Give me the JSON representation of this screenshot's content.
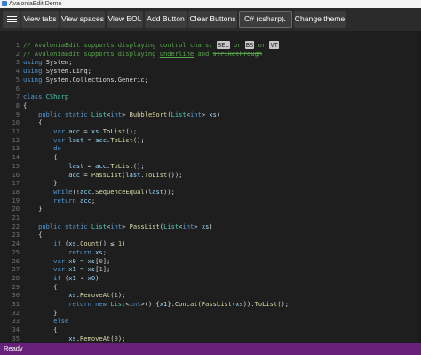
{
  "window": {
    "title": "AvaloniaEdit Demo"
  },
  "toolbar": {
    "buttons": [
      {
        "label": "View tabs"
      },
      {
        "label": "View spaces"
      },
      {
        "label": "View EOL"
      },
      {
        "label": "Add Button"
      },
      {
        "label": "Clear Buttons"
      }
    ],
    "language_select": {
      "selected": "C# (csharp)"
    },
    "theme_button": {
      "label": "Change theme"
    }
  },
  "editor": {
    "lines": [
      {
        "n": "1",
        "t": [
          [
            "cm",
            "// AvaloniaEdit supports displaying control chars: "
          ],
          [
            "ctl",
            "BEL"
          ],
          [
            "cm",
            " or "
          ],
          [
            "ctl",
            "BS"
          ],
          [
            "cm",
            " or "
          ],
          [
            "ctl",
            "VT"
          ]
        ]
      },
      {
        "n": "2",
        "t": [
          [
            "cm",
            "// AvaloniaEdit supports displaying "
          ],
          [
            "cmul",
            "underline"
          ],
          [
            "cm",
            " and "
          ],
          [
            "cmst",
            "strikethrough"
          ]
        ]
      },
      {
        "n": "3",
        "t": [
          [
            "kw",
            "using "
          ],
          [
            "pl",
            "System;"
          ]
        ]
      },
      {
        "n": "4",
        "t": [
          [
            "kw",
            "using "
          ],
          [
            "pl",
            "System.Linq;"
          ]
        ]
      },
      {
        "n": "5",
        "t": [
          [
            "kw",
            "using "
          ],
          [
            "pl",
            "System.Collections.Generic;"
          ]
        ]
      },
      {
        "n": "6",
        "t": []
      },
      {
        "n": "7",
        "t": [
          [
            "kw",
            "class "
          ],
          [
            "ty",
            "CSharp"
          ]
        ]
      },
      {
        "n": "8",
        "t": [
          [
            "pl",
            "{"
          ]
        ]
      },
      {
        "n": "9",
        "t": [
          [
            "pl",
            "    "
          ],
          [
            "kw",
            "public static "
          ],
          [
            "ty",
            "List"
          ],
          [
            "pl",
            "<"
          ],
          [
            "kw",
            "int"
          ],
          [
            "pl",
            "> "
          ],
          [
            "fn",
            "BubbleSort"
          ],
          [
            "pl",
            "("
          ],
          [
            "ty",
            "List"
          ],
          [
            "pl",
            "<"
          ],
          [
            "kw",
            "int"
          ],
          [
            "pl",
            "> "
          ],
          [
            "id",
            "xs"
          ],
          [
            "pl",
            ")"
          ]
        ]
      },
      {
        "n": "10",
        "t": [
          [
            "pl",
            "    {"
          ]
        ]
      },
      {
        "n": "11",
        "t": [
          [
            "pl",
            "        "
          ],
          [
            "kw",
            "var "
          ],
          [
            "id",
            "acc"
          ],
          [
            "pl",
            " = "
          ],
          [
            "id",
            "xs"
          ],
          [
            "pl",
            "."
          ],
          [
            "fn",
            "ToList"
          ],
          [
            "pl",
            "();"
          ]
        ]
      },
      {
        "n": "12",
        "t": [
          [
            "pl",
            "        "
          ],
          [
            "kw",
            "var "
          ],
          [
            "id",
            "last"
          ],
          [
            "pl",
            " = "
          ],
          [
            "id",
            "acc"
          ],
          [
            "pl",
            "."
          ],
          [
            "fn",
            "ToList"
          ],
          [
            "pl",
            "();"
          ]
        ]
      },
      {
        "n": "13",
        "t": [
          [
            "pl",
            "        "
          ],
          [
            "kw",
            "do"
          ]
        ]
      },
      {
        "n": "14",
        "t": [
          [
            "pl",
            "        {"
          ]
        ]
      },
      {
        "n": "15",
        "t": [
          [
            "pl",
            "            "
          ],
          [
            "id",
            "last"
          ],
          [
            "pl",
            " = "
          ],
          [
            "id",
            "acc"
          ],
          [
            "pl",
            "."
          ],
          [
            "fn",
            "ToList"
          ],
          [
            "pl",
            "();"
          ]
        ]
      },
      {
        "n": "16",
        "t": [
          [
            "pl",
            "            "
          ],
          [
            "id",
            "acc"
          ],
          [
            "pl",
            " = "
          ],
          [
            "fn",
            "PassList"
          ],
          [
            "pl",
            "("
          ],
          [
            "id",
            "last"
          ],
          [
            "pl",
            "."
          ],
          [
            "fn",
            "ToList"
          ],
          [
            "pl",
            "());"
          ]
        ]
      },
      {
        "n": "17",
        "t": [
          [
            "pl",
            "        }"
          ]
        ]
      },
      {
        "n": "18",
        "t": [
          [
            "pl",
            "        "
          ],
          [
            "kw",
            "while"
          ],
          [
            "pl",
            "(!"
          ],
          [
            "id",
            "acc"
          ],
          [
            "pl",
            "."
          ],
          [
            "fn",
            "SequenceEqual"
          ],
          [
            "pl",
            "("
          ],
          [
            "id",
            "last"
          ],
          [
            "pl",
            "));"
          ]
        ]
      },
      {
        "n": "19",
        "t": [
          [
            "pl",
            "        "
          ],
          [
            "kw",
            "return "
          ],
          [
            "id",
            "acc"
          ],
          [
            "pl",
            ";"
          ]
        ]
      },
      {
        "n": "20",
        "t": [
          [
            "pl",
            "    }"
          ]
        ]
      },
      {
        "n": "21",
        "t": []
      },
      {
        "n": "22",
        "t": [
          [
            "pl",
            "    "
          ],
          [
            "kw",
            "public static "
          ],
          [
            "ty",
            "List"
          ],
          [
            "pl",
            "<"
          ],
          [
            "kw",
            "int"
          ],
          [
            "pl",
            "> "
          ],
          [
            "fn",
            "PassList"
          ],
          [
            "pl",
            "("
          ],
          [
            "ty",
            "List"
          ],
          [
            "pl",
            "<"
          ],
          [
            "kw",
            "int"
          ],
          [
            "pl",
            "> "
          ],
          [
            "id",
            "xs"
          ],
          [
            "pl",
            ")"
          ]
        ]
      },
      {
        "n": "23",
        "t": [
          [
            "pl",
            "    {"
          ]
        ]
      },
      {
        "n": "24",
        "t": [
          [
            "pl",
            "        "
          ],
          [
            "kw",
            "if "
          ],
          [
            "pl",
            "("
          ],
          [
            "id",
            "xs"
          ],
          [
            "pl",
            "."
          ],
          [
            "fn",
            "Count"
          ],
          [
            "pl",
            "() ≤ "
          ],
          [
            "ng",
            "1"
          ],
          [
            "pl",
            ")"
          ]
        ]
      },
      {
        "n": "25",
        "t": [
          [
            "pl",
            "            "
          ],
          [
            "kw",
            "return "
          ],
          [
            "id",
            "xs"
          ],
          [
            "pl",
            ";"
          ]
        ]
      },
      {
        "n": "26",
        "t": [
          [
            "pl",
            "        "
          ],
          [
            "kw",
            "var "
          ],
          [
            "id",
            "x0"
          ],
          [
            "pl",
            " = "
          ],
          [
            "id",
            "xs"
          ],
          [
            "pl",
            "["
          ],
          [
            "ng",
            "0"
          ],
          [
            "pl",
            "];"
          ]
        ]
      },
      {
        "n": "27",
        "t": [
          [
            "pl",
            "        "
          ],
          [
            "kw",
            "var "
          ],
          [
            "id",
            "x1"
          ],
          [
            "pl",
            " = "
          ],
          [
            "id",
            "xs"
          ],
          [
            "pl",
            "["
          ],
          [
            "ng",
            "1"
          ],
          [
            "pl",
            "];"
          ]
        ]
      },
      {
        "n": "28",
        "t": [
          [
            "pl",
            "        "
          ],
          [
            "kw",
            "if "
          ],
          [
            "pl",
            "("
          ],
          [
            "id",
            "x1"
          ],
          [
            "pl",
            " < "
          ],
          [
            "id",
            "x0"
          ],
          [
            "pl",
            ")"
          ]
        ]
      },
      {
        "n": "29",
        "t": [
          [
            "pl",
            "        {"
          ]
        ]
      },
      {
        "n": "30",
        "t": [
          [
            "pl",
            "            "
          ],
          [
            "id",
            "xs"
          ],
          [
            "pl",
            "."
          ],
          [
            "fn",
            "RemoveAt"
          ],
          [
            "pl",
            "("
          ],
          [
            "ng",
            "1"
          ],
          [
            "pl",
            ");"
          ]
        ]
      },
      {
        "n": "31",
        "t": [
          [
            "pl",
            "            "
          ],
          [
            "kw",
            "return new "
          ],
          [
            "ty",
            "List"
          ],
          [
            "pl",
            "<"
          ],
          [
            "kw",
            "int"
          ],
          [
            "pl",
            ">() {"
          ],
          [
            "id",
            "x1"
          ],
          [
            "pl",
            "}."
          ],
          [
            "fn",
            "Concat"
          ],
          [
            "pl",
            "("
          ],
          [
            "fn",
            "PassList"
          ],
          [
            "pl",
            "("
          ],
          [
            "id",
            "xs"
          ],
          [
            "pl",
            "))."
          ],
          [
            "fn",
            "ToList"
          ],
          [
            "pl",
            "();"
          ]
        ]
      },
      {
        "n": "32",
        "t": [
          [
            "pl",
            "        }"
          ]
        ]
      },
      {
        "n": "33",
        "t": [
          [
            "pl",
            "        "
          ],
          [
            "kw",
            "else"
          ]
        ]
      },
      {
        "n": "34",
        "t": [
          [
            "pl",
            "        {"
          ]
        ]
      },
      {
        "n": "35",
        "t": [
          [
            "pl",
            "            "
          ],
          [
            "id",
            "xs"
          ],
          [
            "pl",
            "."
          ],
          [
            "fn",
            "RemoveAt"
          ],
          [
            "pl",
            "("
          ],
          [
            "ng",
            "0"
          ],
          [
            "pl",
            ");"
          ]
        ]
      }
    ]
  },
  "status": {
    "text": "Ready"
  },
  "colors": {
    "status_bar": "#68217a",
    "comment": "#57a64a",
    "keyword": "#569cd6",
    "type": "#4ec9b0"
  }
}
